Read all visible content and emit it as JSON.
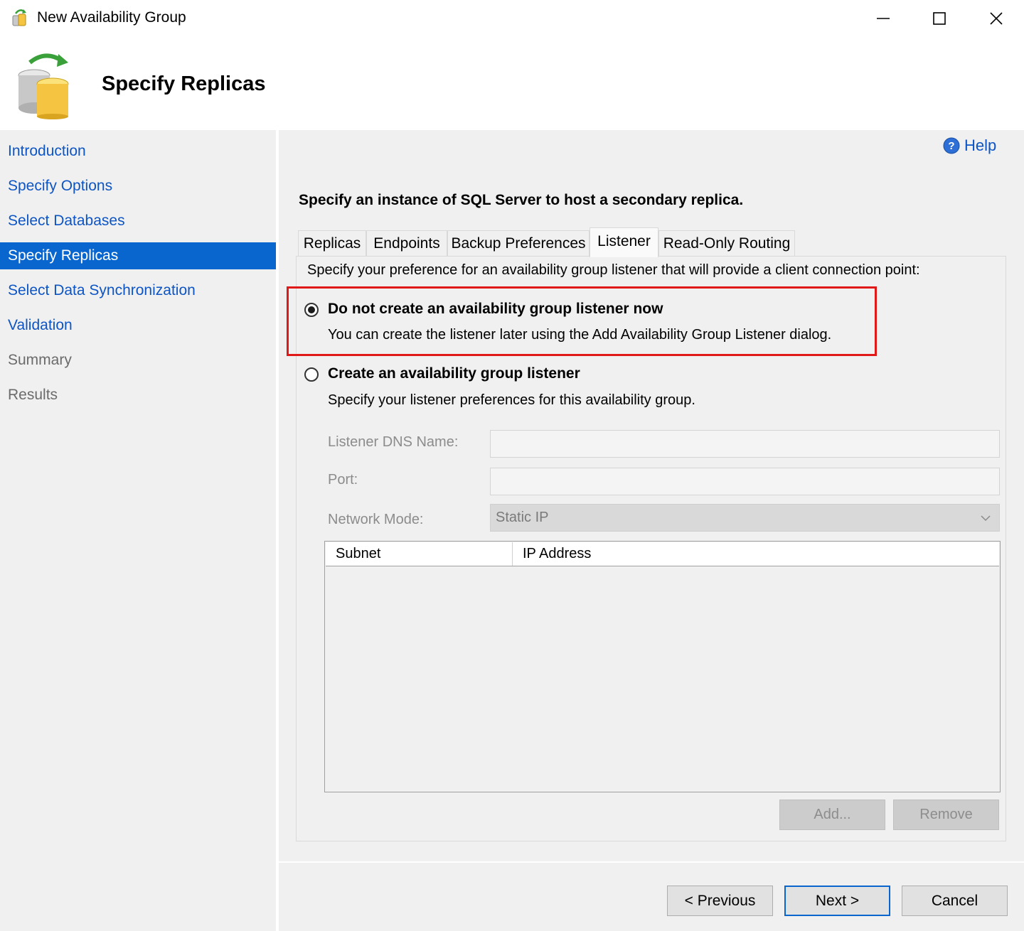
{
  "window": {
    "title": "New Availability Group",
    "icon": "availability-group-icon",
    "controls": [
      "minimize-icon",
      "maximize-icon",
      "close-icon"
    ]
  },
  "header": {
    "title": "Specify Replicas",
    "icon": "database-refresh-icon"
  },
  "nav": {
    "items": [
      {
        "label": "Introduction",
        "state": "link"
      },
      {
        "label": "Specify Options",
        "state": "link"
      },
      {
        "label": "Select Databases",
        "state": "link"
      },
      {
        "label": "Specify Replicas",
        "state": "active"
      },
      {
        "label": "Select Data Synchronization",
        "state": "link"
      },
      {
        "label": "Validation",
        "state": "link"
      },
      {
        "label": "Summary",
        "state": "disabled"
      },
      {
        "label": "Results",
        "state": "disabled"
      }
    ]
  },
  "help": {
    "label": "Help",
    "icon": "help-icon"
  },
  "instruction": "Specify an instance of SQL Server to host a secondary replica.",
  "tabs": [
    {
      "label": "Replicas",
      "active": false
    },
    {
      "label": "Endpoints",
      "active": false
    },
    {
      "label": "Backup Preferences",
      "active": false
    },
    {
      "label": "Listener",
      "active": true
    },
    {
      "label": "Read-Only Routing",
      "active": false
    }
  ],
  "listener": {
    "preference_text": "Specify your preference for an availability group listener that will provide a client connection point:",
    "option_none": {
      "title": "Do not create an availability group listener now",
      "desc": "You can create the listener later using the Add Availability Group Listener dialog.",
      "selected": true
    },
    "option_create": {
      "title": "Create an availability group listener",
      "desc": "Specify your listener preferences for this availability group.",
      "selected": false
    },
    "dns_label": "Listener DNS Name:",
    "dns_value": "",
    "port_label": "Port:",
    "port_value": "",
    "network_label": "Network Mode:",
    "network_value": "Static IP",
    "grid_columns": [
      "Subnet",
      "IP Address"
    ],
    "grid_rows": [],
    "add_label": "Add...",
    "remove_label": "Remove"
  },
  "footer": {
    "previous_label": "< Previous",
    "next_label": "Next >",
    "cancel_label": "Cancel"
  },
  "colors": {
    "link": "#0d55c4",
    "active_nav_bg": "#0a66cf",
    "highlight_border": "#e01818",
    "panel_bg": "#f0f0f0"
  }
}
